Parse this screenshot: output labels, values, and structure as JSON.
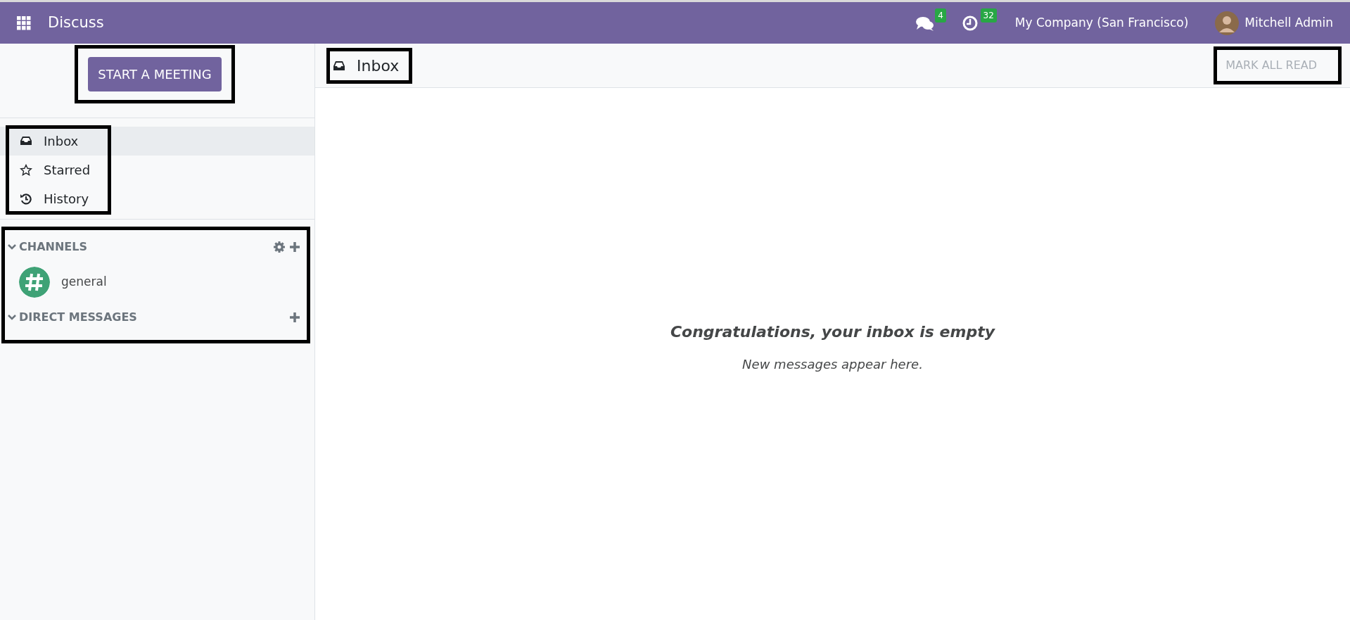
{
  "navbar": {
    "app_name": "Discuss",
    "messages_badge": "4",
    "activities_badge": "32",
    "company": "My Company (San Francisco)",
    "user": "Mitchell Admin"
  },
  "sidebar": {
    "start_meeting": "START A MEETING",
    "mailboxes": [
      {
        "kind": "inbox",
        "label": "Inbox",
        "selected": true
      },
      {
        "kind": "star",
        "label": "Starred",
        "selected": false
      },
      {
        "kind": "history",
        "label": "History",
        "selected": false
      }
    ],
    "categories": [
      {
        "title": "CHANNELS",
        "expanded": true,
        "has_settings": true,
        "items": [
          {
            "label": "general",
            "color": "#3fa276"
          }
        ]
      },
      {
        "title": "DIRECT MESSAGES",
        "expanded": true,
        "has_settings": false
      }
    ]
  },
  "main": {
    "title": "Inbox",
    "mark_all_read": {
      "label": "MARK ALL READ",
      "disabled": true
    },
    "empty_title": "Congratulations, your inbox is empty",
    "empty_text": "New messages appear here."
  }
}
